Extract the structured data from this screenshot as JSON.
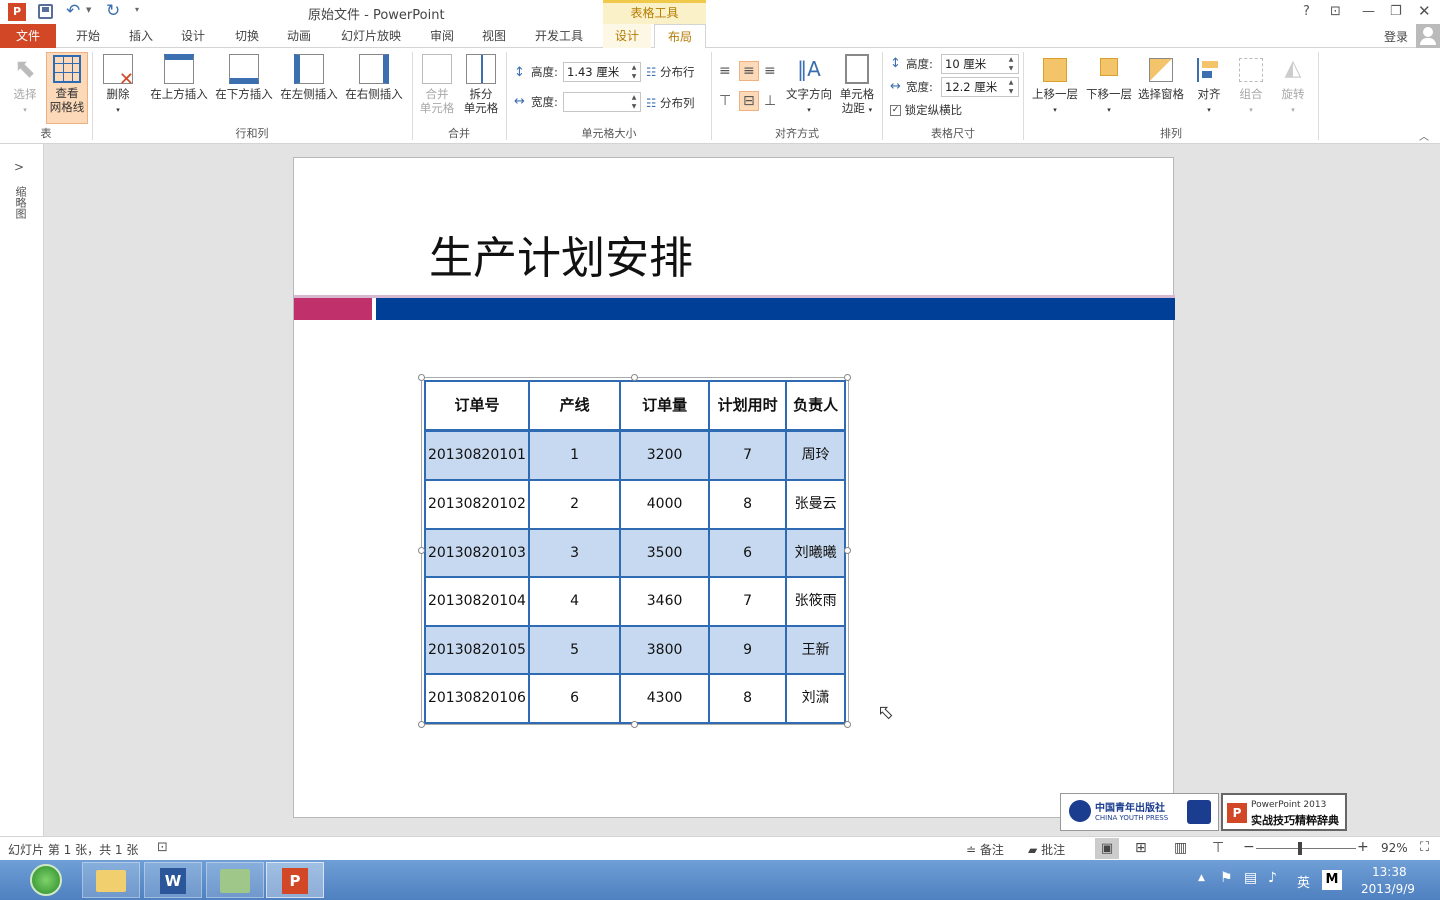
{
  "app": {
    "title": "原始文件 - PowerPoint",
    "context_label": "表格工具",
    "help": "?",
    "login": "登录"
  },
  "tabs": {
    "file": "文件",
    "home": "开始",
    "insert": "插入",
    "design": "设计",
    "transitions": "切换",
    "animations": "动画",
    "slideshow": "幻灯片放映",
    "review": "审阅",
    "view": "视图",
    "developer": "开发工具",
    "tdesign": "设计",
    "layout": "布局"
  },
  "ribbon": {
    "table": {
      "select": "选择",
      "gridlines_1": "查看",
      "gridlines_2": "网格线",
      "label": "表"
    },
    "rows": {
      "delete": "删除",
      "above": "在上方插入",
      "below": "在下方插入",
      "left": "在左侧插入",
      "right": "在右侧插入",
      "label": "行和列"
    },
    "merge": {
      "merge_1": "合并",
      "merge_2": "单元格",
      "split_1": "拆分",
      "split_2": "单元格",
      "label": "合并"
    },
    "cellsize": {
      "height_label": "高度:",
      "height_value": "1.43 厘米",
      "width_label": "宽度:",
      "width_value": "",
      "dist_rows": "分布行",
      "dist_cols": "分布列",
      "label": "单元格大小"
    },
    "align": {
      "text_dir": "文字方向",
      "margins_1": "单元格",
      "margins_2": "边距",
      "label": "对齐方式"
    },
    "tablesize": {
      "height_label": "高度:",
      "height_value": "10 厘米",
      "width_label": "宽度:",
      "width_value": "12.2 厘米",
      "lock": "锁定纵横比",
      "label": "表格尺寸"
    },
    "arrange": {
      "forward": "上移一层",
      "backward": "下移一层",
      "pane": "选择窗格",
      "align": "对齐",
      "group": "组合",
      "rotate": "旋转",
      "label": "排列"
    }
  },
  "left_panel": {
    "label": "缩略图"
  },
  "slide": {
    "title": "生产计划安排"
  },
  "table": {
    "headers": [
      "订单号",
      "产线",
      "订单量",
      "计划用时",
      "负责人"
    ],
    "rows": [
      [
        "20130820101",
        "1",
        "3200",
        "7",
        "周玲"
      ],
      [
        "20130820102",
        "2",
        "4000",
        "8",
        "张曼云"
      ],
      [
        "20130820103",
        "3",
        "3500",
        "6",
        "刘曦曦"
      ],
      [
        "20130820104",
        "4",
        "3460",
        "7",
        "张筱雨"
      ],
      [
        "20130820105",
        "5",
        "3800",
        "9",
        "王新"
      ],
      [
        "20130820106",
        "6",
        "4300",
        "8",
        "刘潇"
      ]
    ]
  },
  "logos": {
    "cyp_cn": "中国青年出版社",
    "cyp_en": "CHINA YOUTH PRESS",
    "book_1": "PowerPoint 2013",
    "book_2": "实战技巧精粹辞典"
  },
  "status": {
    "slide_info": "幻灯片 第 1 张，共 1 张",
    "notes": "备注",
    "comments": "批注",
    "zoom": "92%"
  },
  "taskbar": {
    "time": "13:38",
    "date": "2013/9/9",
    "ime": "英",
    "ime2": "M"
  },
  "colors": {
    "file_tab": "#d24726",
    "accent_pink": "#c0306a",
    "accent_blue": "#003f98",
    "table_border": "#2e6bb2",
    "row_fill": "#c7d9f0"
  }
}
